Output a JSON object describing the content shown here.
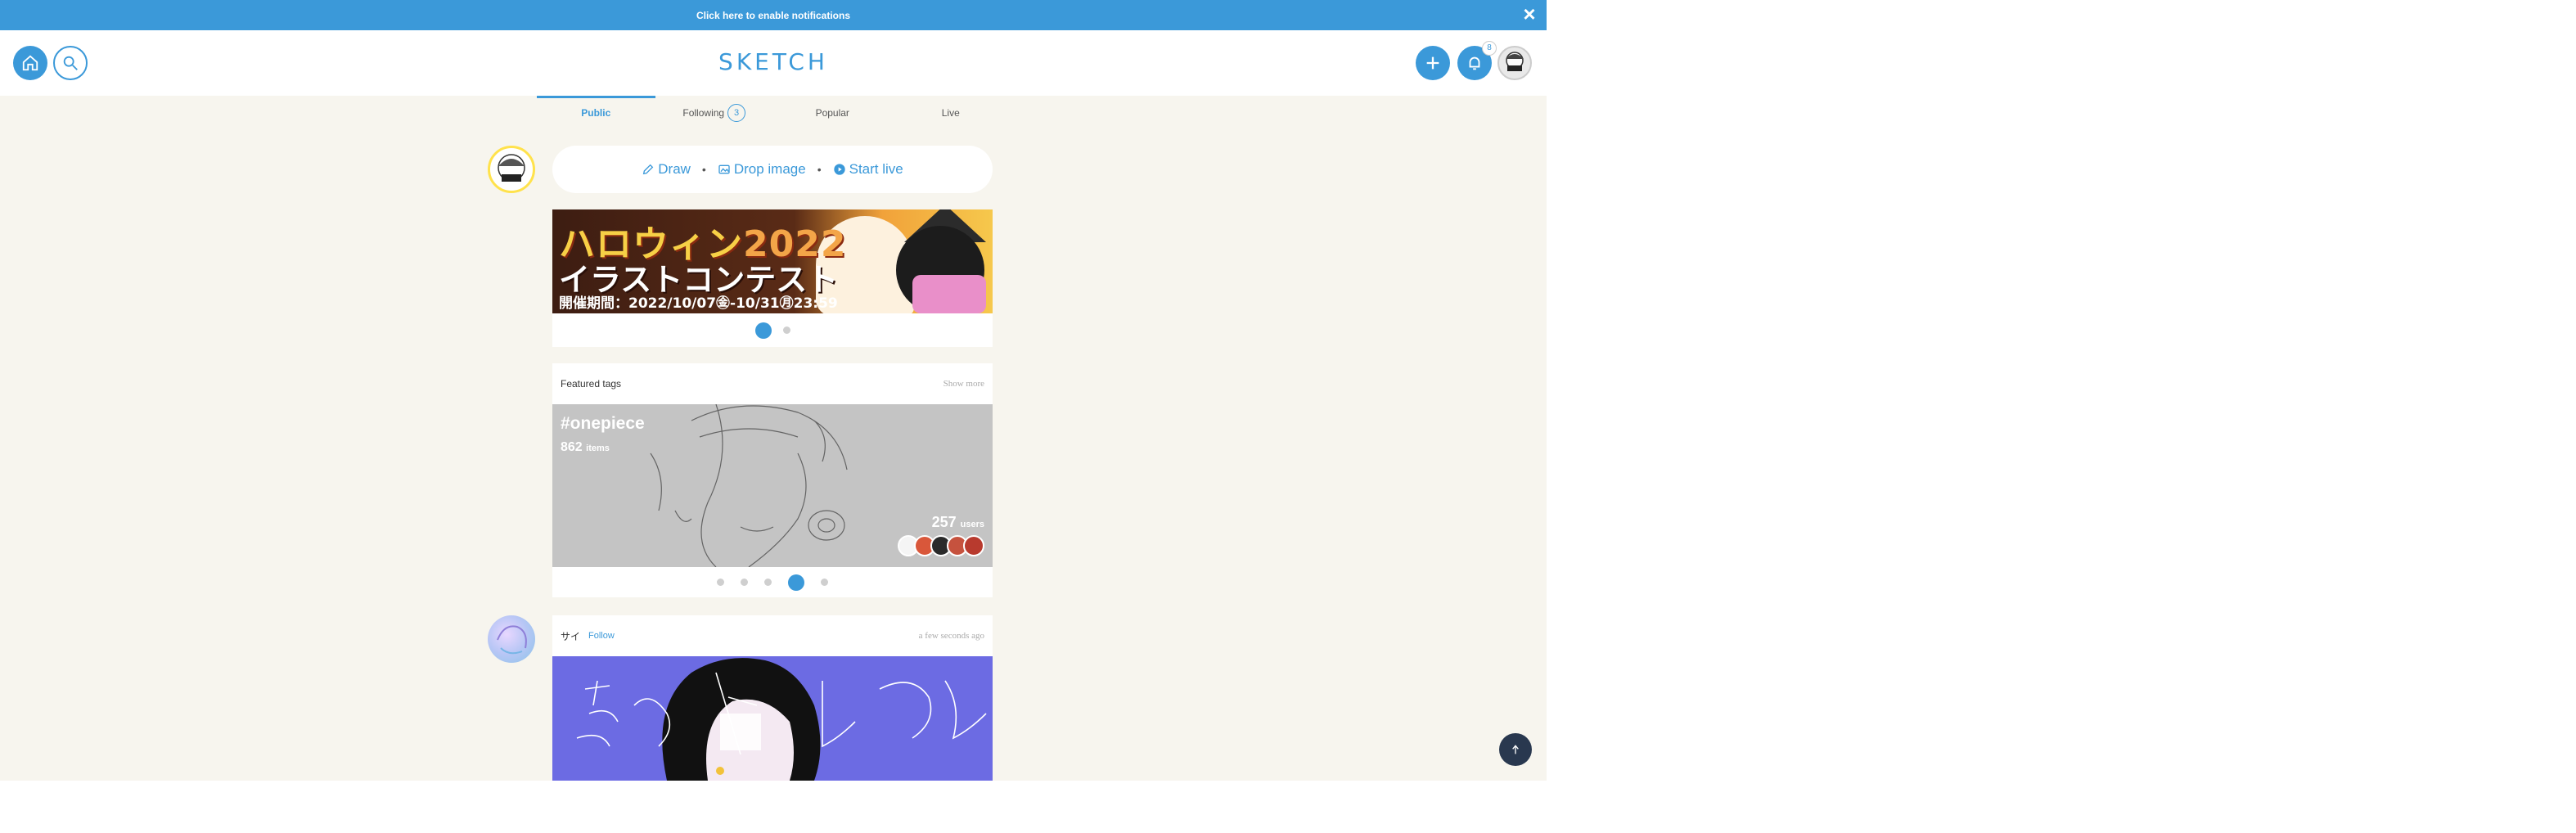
{
  "notification": {
    "text": "Click here to enable notifications",
    "close": "×"
  },
  "header": {
    "logo": "SKETCH",
    "notification_count": "8"
  },
  "tabs": [
    {
      "label": "Public",
      "active": true
    },
    {
      "label": "Following",
      "count": "3"
    },
    {
      "label": "Popular"
    },
    {
      "label": "Live"
    }
  ],
  "compose": {
    "draw": "Draw",
    "drop_image": "Drop image",
    "start_live": "Start live",
    "separator": "•"
  },
  "banner": {
    "title_jp": "ハロウィン",
    "year": "2022",
    "subtitle_jp": "イラストコンテスト",
    "period": "開催期間：2022/10/07㊎-10/31㊊23:59",
    "active_slide": 0,
    "slides": 2
  },
  "featured_tags": {
    "title": "Featured tags",
    "show_more": "Show more",
    "tag": "#onepiece",
    "items_count": "862",
    "items_label": "items",
    "users_count": "257",
    "users_label": "users",
    "active_slide": 3,
    "slides": 5
  },
  "post": {
    "username": "サイ",
    "follow": "Follow",
    "time": "a few seconds ago"
  },
  "colors": {
    "accent": "#3b99d9",
    "background": "#f7f5ee",
    "scroll_top": "#29384f"
  }
}
